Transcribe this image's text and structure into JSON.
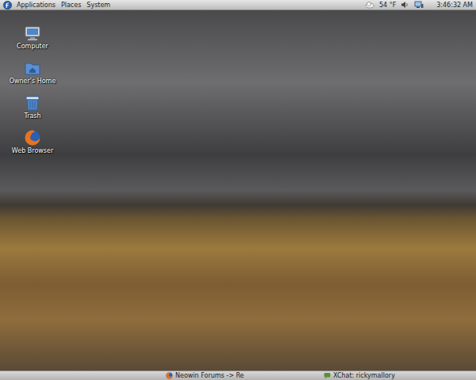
{
  "top_panel": {
    "menus": [
      "Applications",
      "Places",
      "System"
    ],
    "weather": "54 °F",
    "clock": "3:46:32 AM"
  },
  "desktop_icons": [
    {
      "label": "Computer",
      "kind": "computer"
    },
    {
      "label": "Owner's Home",
      "kind": "home"
    },
    {
      "label": "Trash",
      "kind": "trash"
    },
    {
      "label": "Web Browser",
      "kind": "browser"
    }
  ],
  "taskbar": [
    {
      "title": "Neowin Forums -> Re",
      "kind": "browser",
      "selected": false
    },
    {
      "title": "XChat: rickymallory",
      "kind": "chat",
      "selected": false
    }
  ]
}
